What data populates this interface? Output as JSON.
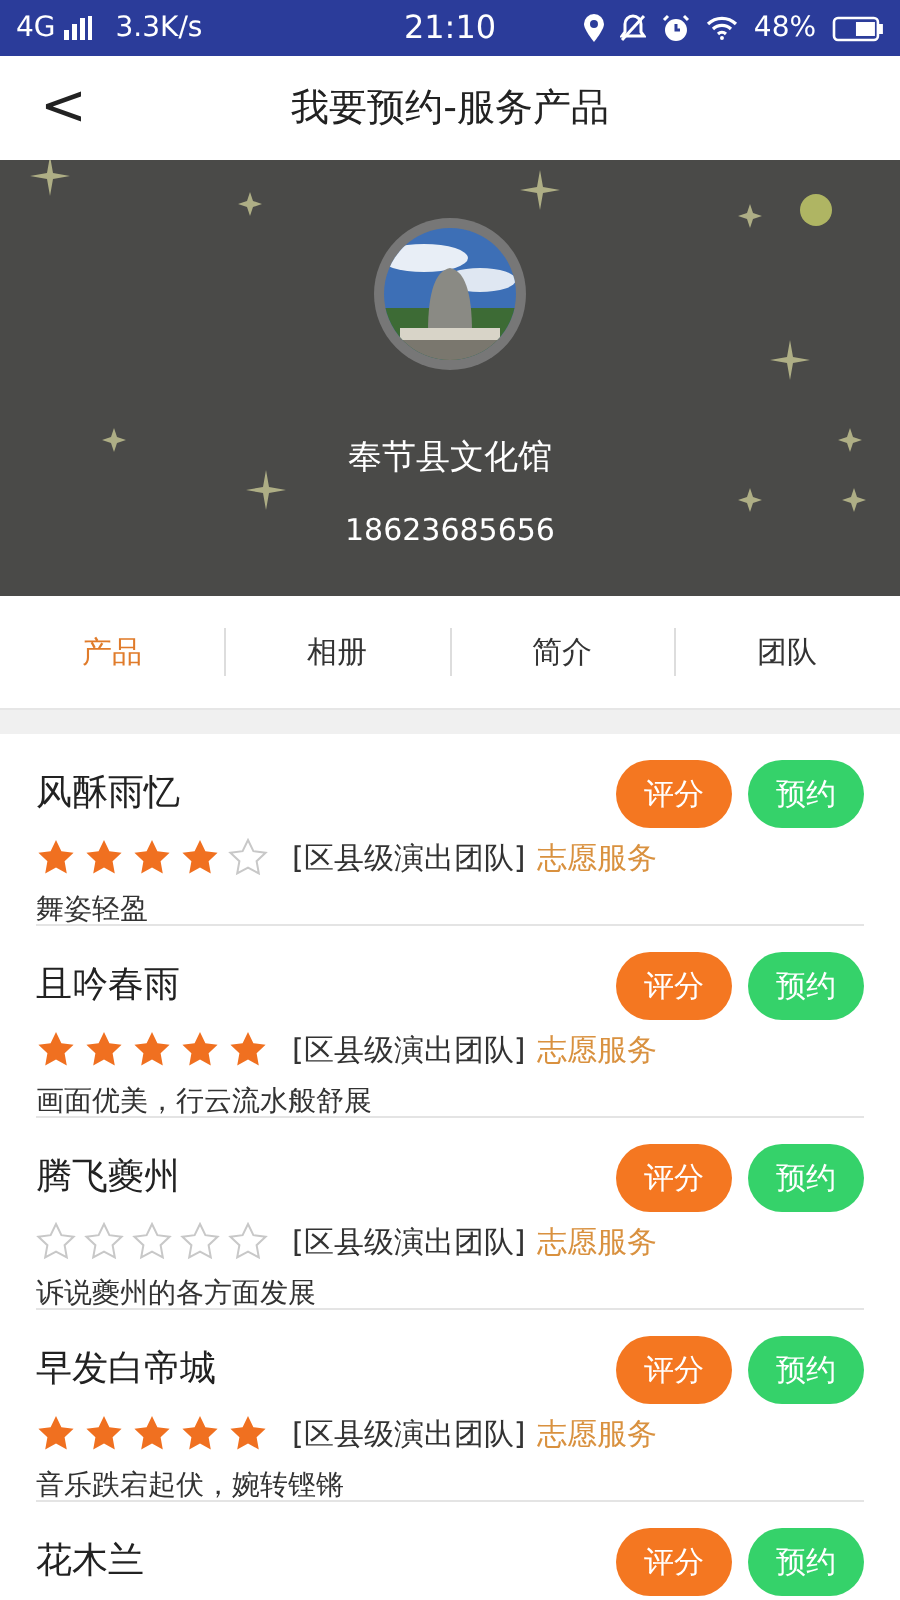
{
  "status_bar": {
    "network": "4G",
    "speed": "3.3K/s",
    "time": "21:10",
    "battery": "48%"
  },
  "header": {
    "back": "<",
    "title": "我要预约-服务产品"
  },
  "profile": {
    "name": "奉节县文化馆",
    "phone": "18623685656"
  },
  "tabs": [
    {
      "label": "产品",
      "selected": true
    },
    {
      "label": "相册",
      "selected": false
    },
    {
      "label": "简介",
      "selected": false
    },
    {
      "label": "团队",
      "selected": false
    }
  ],
  "products": [
    {
      "title": "风酥雨忆",
      "stars": 4,
      "category": "[区县级演出团队]",
      "tag": "志愿服务",
      "description": "舞姿轻盈",
      "buttons": [
        "评分",
        "预约"
      ]
    },
    {
      "title": "且吟春雨",
      "stars": 5,
      "category": "[区县级演出团队]",
      "tag": "志愿服务",
      "description": "画面优美，行云流水般舒展",
      "buttons": [
        "评分",
        "预约"
      ]
    },
    {
      "title": "腾飞夔州",
      "stars": 0,
      "category": "[区县级演出团队]",
      "tag": "志愿服务",
      "description": "诉说夔州的各方面发展",
      "buttons": [
        "评分",
        "预约"
      ]
    },
    {
      "title": "早发白帝城",
      "stars": 5,
      "category": "[区县级演出团队]",
      "tag": "志愿服务",
      "description": "音乐跌宕起伏，婉转铿锵",
      "buttons": [
        "评分",
        "预约"
      ]
    },
    {
      "title": "花木兰",
      "buttons": [
        "评分",
        "预约"
      ]
    }
  ]
}
